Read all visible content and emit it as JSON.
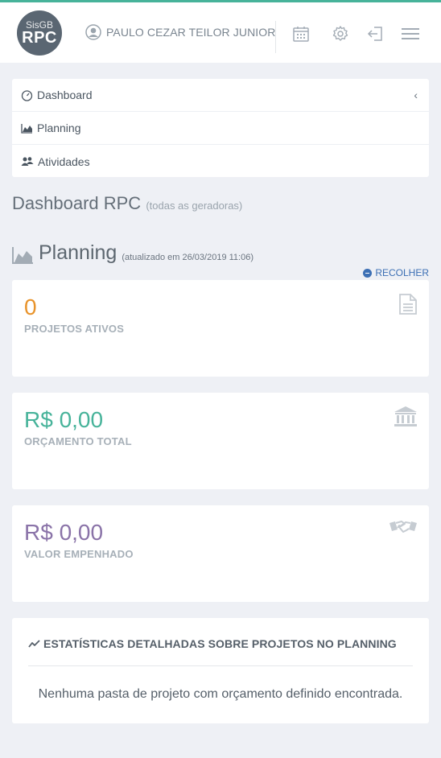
{
  "header": {
    "logo_line1": "SisGB",
    "logo_line2": "RPC",
    "user_name": "PAULO CEZAR TEILOR JUNIOR"
  },
  "menu": {
    "items": [
      {
        "label": "Dashboard",
        "icon": "dashboard-gauge-icon"
      },
      {
        "label": "Planning",
        "icon": "area-chart-icon"
      },
      {
        "label": "Atividades",
        "icon": "users-icon"
      }
    ],
    "collapse_glyph": "‹"
  },
  "page": {
    "title": "Dashboard RPC",
    "subtitle": "(todas as geradoras)"
  },
  "planning": {
    "title": "Planning",
    "updated": "(atualizado em 26/03/2019 11:06)",
    "collapse_label": "RECOLHER"
  },
  "stats": [
    {
      "value": "0",
      "label": "PROJETOS ATIVOS",
      "color": "#e8932a",
      "icon": "document-icon"
    },
    {
      "value": "R$ 0,00",
      "label": "ORÇAMENTO TOTAL",
      "color": "#47b39a",
      "icon": "bank-icon"
    },
    {
      "value": "R$ 0,00",
      "label": "VALOR EMPENHADO",
      "color": "#8a73a8",
      "icon": "handshake-icon"
    }
  ],
  "details": {
    "title": "ESTATÍSTICAS DETALHADAS SOBRE PROJETOS NO PLANNING",
    "empty_message": "Nenhuma pasta de projeto com orçamento definido encontrada."
  },
  "colors": {
    "accent": "#47b39a",
    "link": "#3c6fb4",
    "background": "#eef0f5"
  }
}
